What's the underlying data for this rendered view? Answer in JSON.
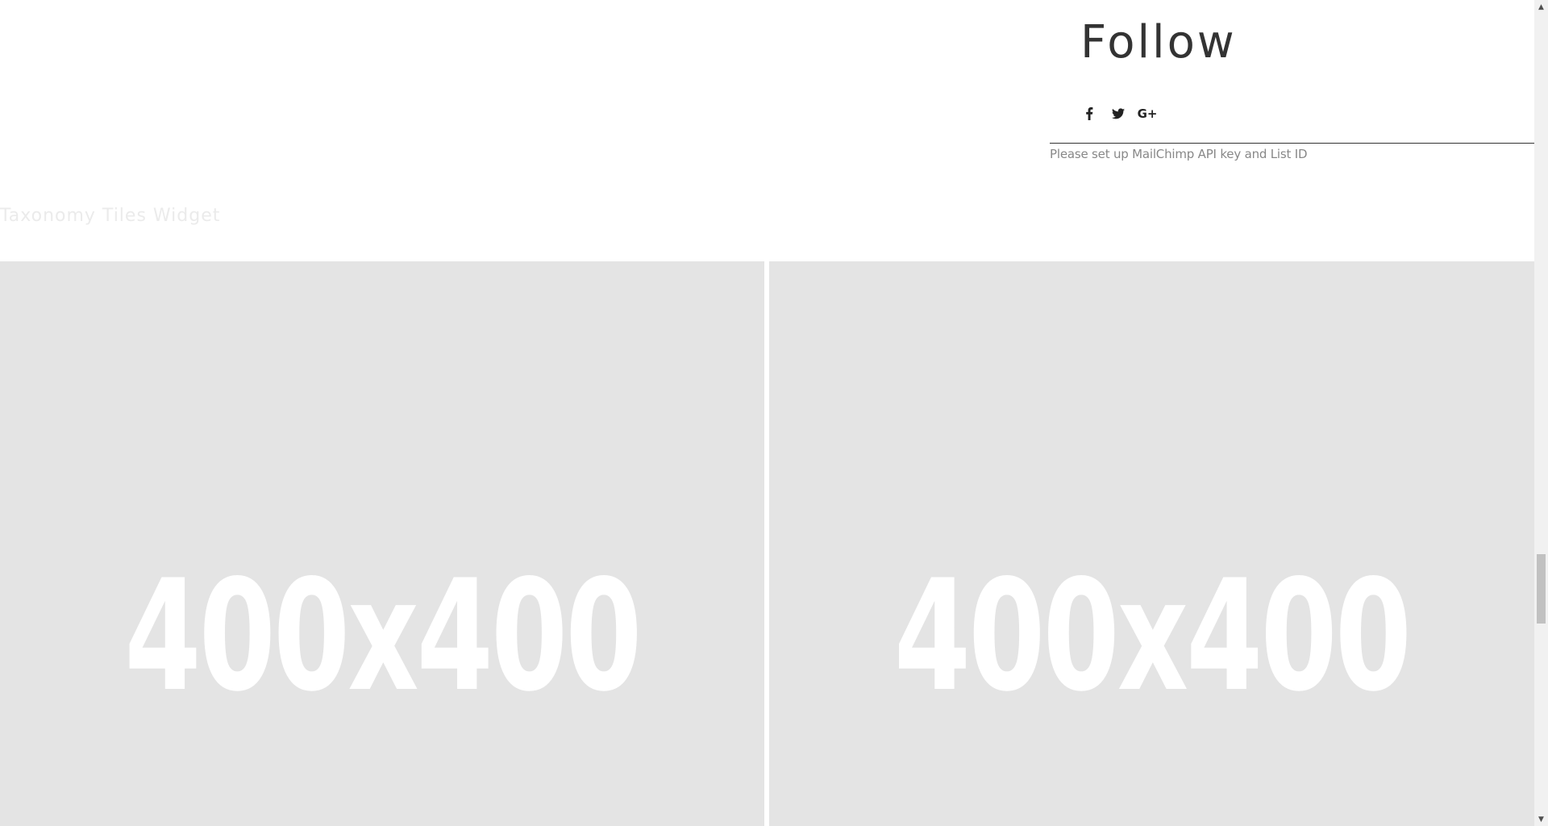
{
  "follow_widget": {
    "title": "Follow",
    "social_icons": [
      {
        "name": "facebook-icon",
        "glyph": "f"
      },
      {
        "name": "twitter-icon",
        "glyph": "t"
      },
      {
        "name": "google-plus-icon",
        "glyph": "G+"
      }
    ],
    "mailchimp_note": "Please set up MailChimp API key and List ID"
  },
  "taxonomy_tiles": {
    "heading": "Taxonomy Tiles Widget",
    "tiles": [
      {
        "label": "400x400"
      },
      {
        "label": "400x400"
      }
    ]
  },
  "scrollbar": {
    "up_glyph": "▲",
    "down_glyph": "▼"
  }
}
